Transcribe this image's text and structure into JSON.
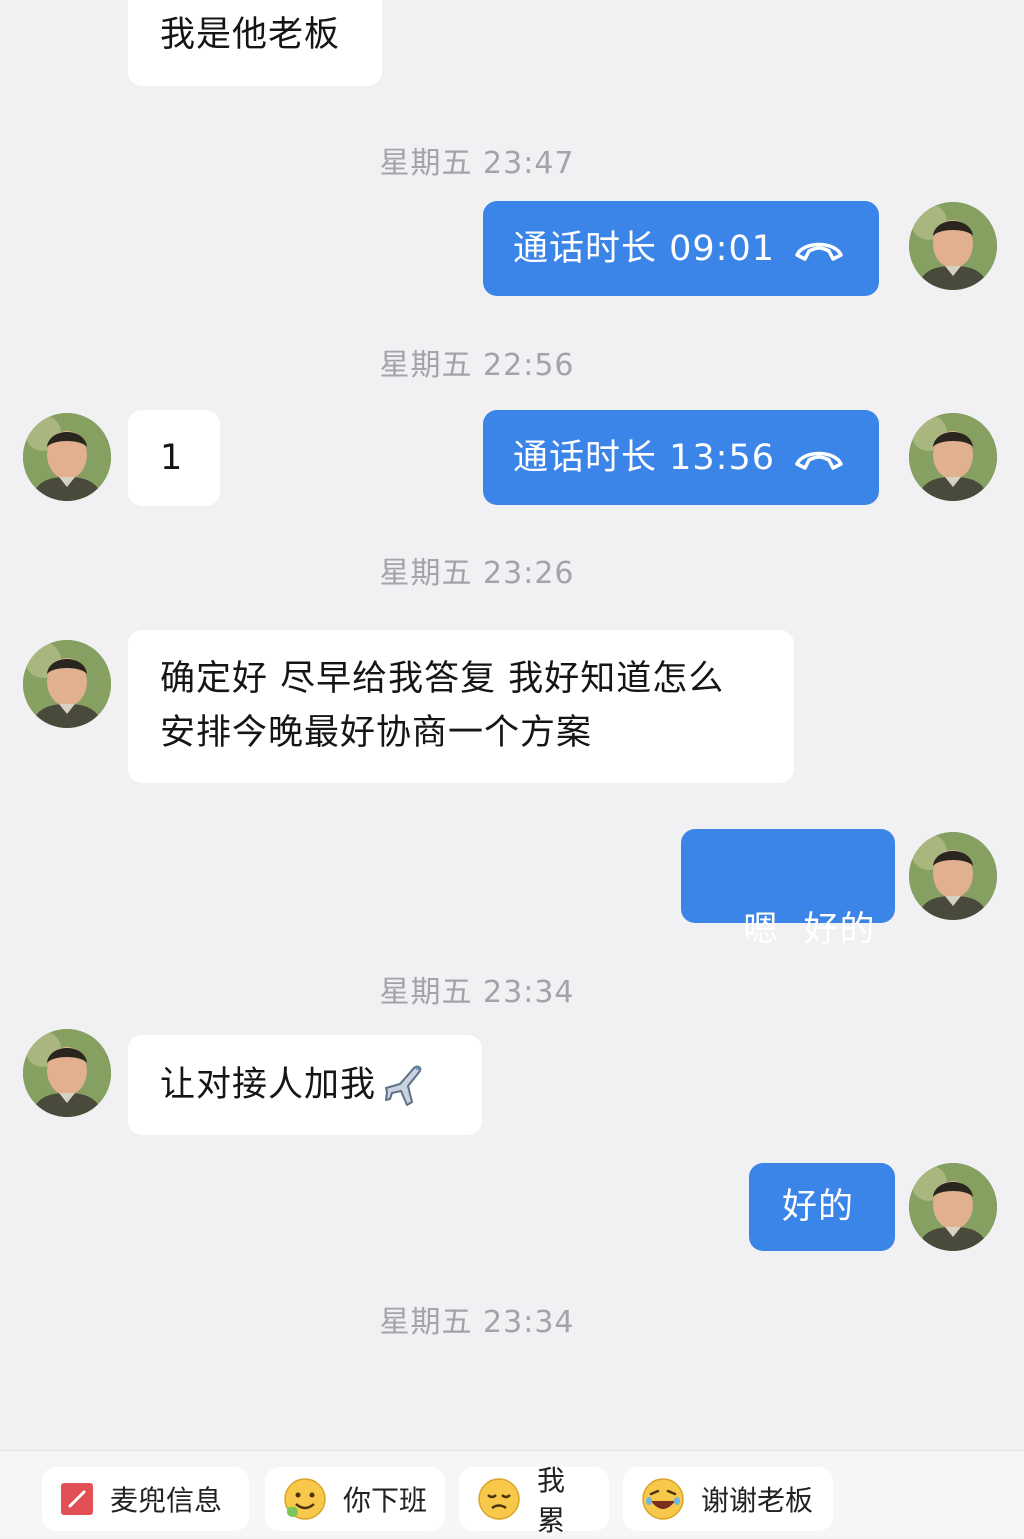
{
  "colors": {
    "background": "#f1f1f3",
    "incoming_bubble": "#ffffff",
    "outgoing_bubble": "#3b84e8",
    "timestamp": "#a4a4a8"
  },
  "messages": {
    "top_left": {
      "text": "我是他老板"
    },
    "ts1": "星期五 23:47",
    "call1": {
      "label": "通话时长 09:01",
      "icon": "hang-up-phone-icon"
    },
    "ts2": "星期五 22:56",
    "left_one": {
      "text": "1"
    },
    "call2": {
      "label": "通话时长 13:56",
      "icon": "hang-up-phone-icon"
    },
    "ts3": "星期五 23:26",
    "long_msg": {
      "line1": "确定好 尽早给我答复 我好知道怎么",
      "line2": "安排今晚最好协商一个方案"
    },
    "reply1": {
      "text": "嗯  好的"
    },
    "ts4": "星期五 23:34",
    "left_last": {
      "text": "让对接人加我",
      "icon": "airplane-icon"
    },
    "reply2": {
      "text": "好的"
    },
    "ts5": "星期五 23:34"
  },
  "quick_replies": [
    {
      "label": "麦兜信息",
      "icon": "red-note-icon"
    },
    {
      "label": "你下班",
      "icon": "drooling-emoji-icon"
    },
    {
      "label": "我累",
      "icon": "sad-emoji-icon"
    },
    {
      "label": "谢谢老板",
      "icon": "laughing-emoji-icon"
    }
  ]
}
